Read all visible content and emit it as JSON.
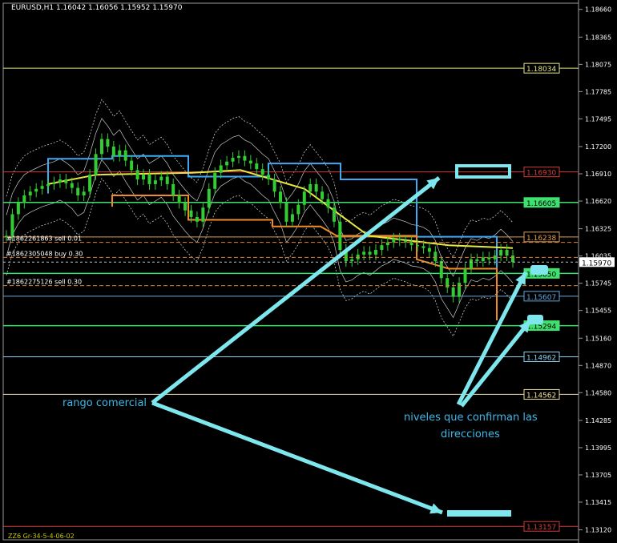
{
  "window": {
    "title": "EURUSD,H1  1.16042 1.16056 1.15952 1.15970",
    "footer": "ZZ6 Gr-34-5-4-06-02"
  },
  "chart_data": {
    "type": "candlestick",
    "symbol": "EURUSD",
    "timeframe": "H1",
    "ohlc_header": {
      "open": 1.16042,
      "high": 1.16056,
      "low": 1.15952,
      "close": 1.1597
    },
    "current_price": 1.1597,
    "ylim": [
      1.1298,
      1.1876
    ],
    "y_ticks": [
      "1.18660",
      "1.18365",
      "1.18075",
      "1.17785",
      "1.17495",
      "1.17200",
      "1.16910",
      "1.16620",
      "1.16325",
      "1.16035",
      "1.15745",
      "1.15455",
      "1.15160",
      "1.14870",
      "1.14580",
      "1.14285",
      "1.13995",
      "1.13705",
      "1.13415",
      "1.13120"
    ],
    "levels": [
      {
        "price": 1.18034,
        "label": "1.18034",
        "color": "#e6e68a"
      },
      {
        "price": 1.1693,
        "label": "1.16930",
        "color": "#d23c3c"
      },
      {
        "price": 1.16605,
        "label": "1.16605",
        "color": "#40e070",
        "highlight": true
      },
      {
        "price": 1.16238,
        "label": "1.16238",
        "color": "#e0a050"
      },
      {
        "price": 1.1585,
        "label": "1.15850",
        "color": "#40e070",
        "highlight": true
      },
      {
        "price": 1.15607,
        "label": "1.15607",
        "color": "#60a8e0"
      },
      {
        "price": 1.15294,
        "label": "1.15294",
        "color": "#40e070",
        "highlight": true
      },
      {
        "price": 1.14962,
        "label": "1.14962",
        "color": "#8ad0f0"
      },
      {
        "price": 1.14562,
        "label": "1.14562",
        "color": "#f0e0a0"
      },
      {
        "price": 1.13157,
        "label": "1.13157",
        "color": "#d23c3c"
      }
    ],
    "orders": [
      {
        "label": "#1862261863 sell 0.01",
        "price": 1.1618
      },
      {
        "label": "#1862305048 buy 0.30",
        "price": 1.1602
      },
      {
        "label": "#1862275126 sell 0.30",
        "price": 1.1572
      }
    ],
    "closes": [
      1.1625,
      1.1648,
      1.166,
      1.1668,
      1.1672,
      1.1675,
      1.1678,
      1.168,
      1.1682,
      1.1685,
      1.1681,
      1.1676,
      1.1668,
      1.1672,
      1.169,
      1.1712,
      1.1728,
      1.172,
      1.171,
      1.1716,
      1.1705,
      1.1695,
      1.1685,
      1.169,
      1.168,
      1.1684,
      1.1688,
      1.168,
      1.1668,
      1.166,
      1.1652,
      1.1645,
      1.164,
      1.1655,
      1.1675,
      1.1692,
      1.17,
      1.1704,
      1.1708,
      1.171,
      1.1705,
      1.1702,
      1.1696,
      1.169,
      1.1685,
      1.1672,
      1.166,
      1.164,
      1.1648,
      1.1658,
      1.1672,
      1.168,
      1.1672,
      1.1664,
      1.1655,
      1.164,
      1.161,
      1.1598,
      1.16,
      1.1605,
      1.1608,
      1.1605,
      1.161,
      1.1615,
      1.1618,
      1.1622,
      1.162,
      1.1618,
      1.1615,
      1.1614,
      1.1612,
      1.1608,
      1.1598,
      1.158,
      1.157,
      1.156,
      1.1575,
      1.159,
      1.16,
      1.1598,
      1.1602,
      1.16,
      1.1604,
      1.161,
      1.1604,
      1.1597
    ],
    "annotations": [
      {
        "text": "rango comercial"
      },
      {
        "text": "niveles que confirman las"
      },
      {
        "text": "direcciones"
      }
    ],
    "grid": false
  }
}
